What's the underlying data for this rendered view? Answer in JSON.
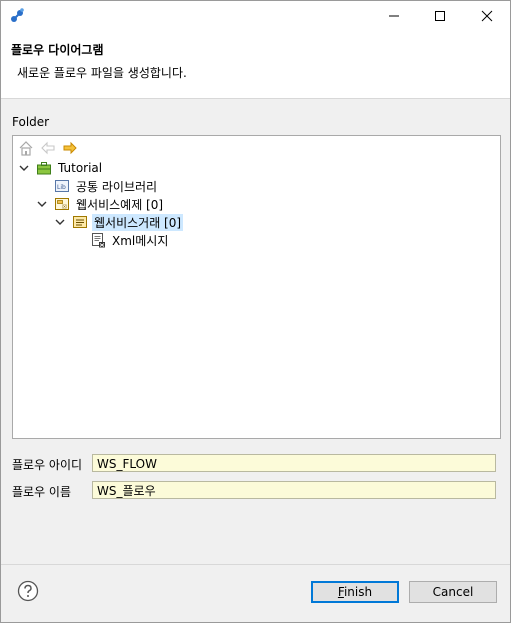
{
  "header": {
    "title": "플로우 다이어그램",
    "description": "새로운 플로우 파일을 생성합니다."
  },
  "folder": {
    "label": "Folder",
    "tree": [
      {
        "label": "Tutorial",
        "icon": "briefcase-icon",
        "expanded": true,
        "level": 0
      },
      {
        "label": "공통 라이브러리",
        "icon": "library-icon",
        "level": 1
      },
      {
        "label": "웹서비스예제 [0]",
        "icon": "package-folder-icon",
        "expanded": true,
        "level": 1
      },
      {
        "label": "웹서비스거래 [0]",
        "icon": "service-icon",
        "expanded": true,
        "level": 2,
        "selected": true
      },
      {
        "label": "Xml메시지",
        "icon": "xml-message-icon",
        "level": 3
      }
    ]
  },
  "fields": {
    "flow_id_label": "플로우 아이디",
    "flow_id_value": "WS_FLOW",
    "flow_name_label": "플로우 이름",
    "flow_name_value": "WS_플로우"
  },
  "buttons": {
    "finish": "Finish",
    "cancel": "Cancel"
  },
  "colors": {
    "selection": "#cde8ff",
    "input_bg": "#fcfbd9",
    "default_button_border": "#0078d7"
  }
}
